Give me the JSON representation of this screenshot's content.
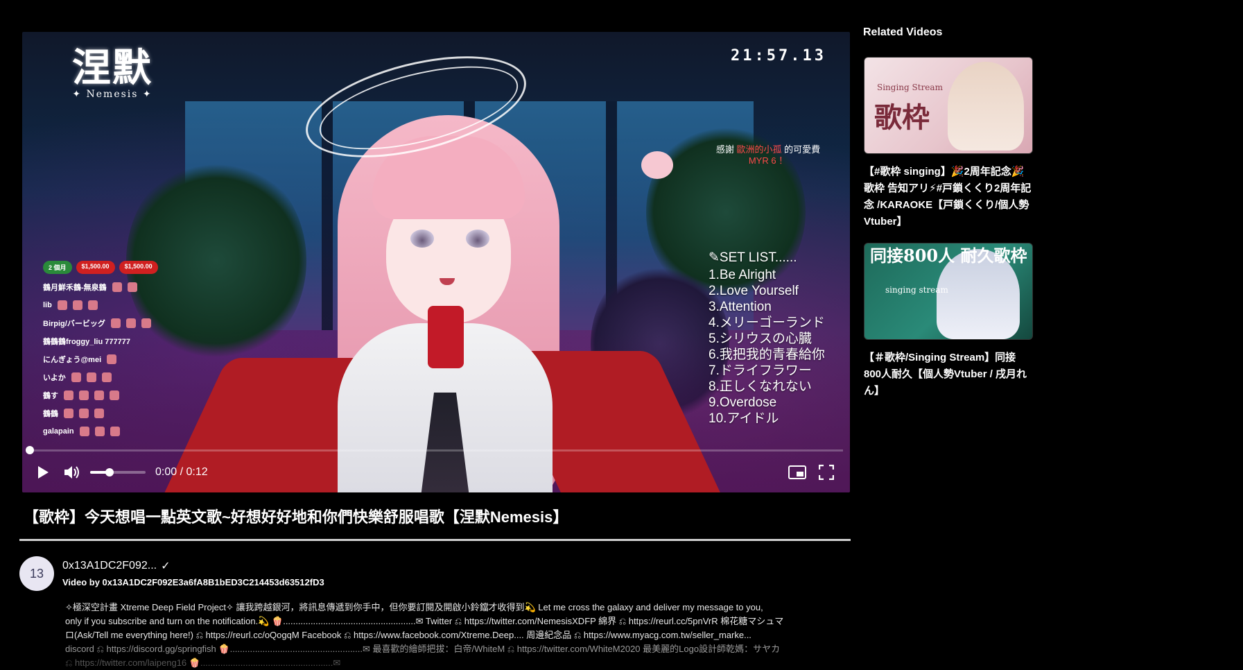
{
  "player": {
    "logo_main": "涅默",
    "logo_sub": "✦ Nemesis ✦",
    "clock": "21:57.13",
    "thanks_prefix": "感謝",
    "thanks_name": "歐洲的小孤",
    "thanks_suffix": "的可愛費",
    "thanks_amount": "MYR 6 ！",
    "setlist_title": "✎SET LIST......",
    "setlist": [
      "1.Be Alright",
      "2.Love Yourself",
      "3.Attention",
      "4.メリーゴーランド",
      "5.シリウスの心臓",
      "6.我把我的青春給你",
      "7.ドライフラワー",
      "8.正しくなれない",
      "9.Overdose",
      "10.アイドル"
    ],
    "chat_badges": [
      "2 個月",
      "$1,500.00",
      "$1,500.00"
    ],
    "chat_lines": [
      "鶴月鮮禾鶴-無泉鶴",
      "lib",
      "Birpig/バービッグ",
      "鶴鶴鶴froggy_liu 777777",
      "にんぎょう@mei",
      "いよか",
      "鶴す",
      "鶴鶴",
      "galapain"
    ],
    "time": "0:00 / 0:12",
    "progress": 0,
    "volume": 0.35
  },
  "video": {
    "title": "【歌枠】今天想唱一點英文歌~好想好好地和你們快樂舒服唱歌【涅默Nemesis】",
    "avatar_text": "13",
    "channel_name": "0x13A1DC2F092...",
    "verified": "✓",
    "byline": "Video by 0x13A1DC2F092E3a6fA8B1bED3C214453d63512fD3",
    "description": [
      "✧極深空計畫 Xtreme Deep Field Project✧ 讓我跨越銀河，將訊息傳遞到你手中，但你要訂閱及開啟小鈴鐺才收得到💫 Let me cross the galaxy and deliver my message to you,",
      "only if you subscribe and turn on the notification.💫 🍿.....................................................✉ Twitter ⎌ https://twitter.com/NemesisXDFP 綿界 ⎌ https://reurl.cc/5pnVrR 棉花糖マシュマ",
      "ロ(Ask/Tell me everything here!) ⎌ https://reurl.cc/oQogqM Facebook ⎌ https://www.facebook.com/Xtreme.Deep.... 周邊紀念品 ⎌ https://www.myacg.com.tw/seller_marke...",
      "discord ⎌ https://discord.gg/springfish 🍿.....................................................✉ 最喜歡的繪師把拔：白帝/WhiteM ⎌ https://twitter.com/WhiteM2020 最美麗的Logo設計師乾媽：サヤカ",
      "⎌ https://twitter.com/laipeng16 🍿.....................................................✉"
    ]
  },
  "sidebar": {
    "title": "Related Videos",
    "items": [
      {
        "thumb_text": "歌枠",
        "thumb_sub": "Singing Stream",
        "title": "【#歌枠 singing】🎉2周年記念🎉歌枠 告知アリ⚡#戸鎖くくり2周年記念 /KARAOKE【戸鎖くくり/個人勢Vtuber】"
      },
      {
        "thumb_text": "同接800人 耐久歌枠",
        "thumb_sub": "singing stream",
        "title": "【＃歌枠/Singing Stream】同接800人耐久【個人勢Vtuber / 戌月れん】"
      }
    ]
  }
}
